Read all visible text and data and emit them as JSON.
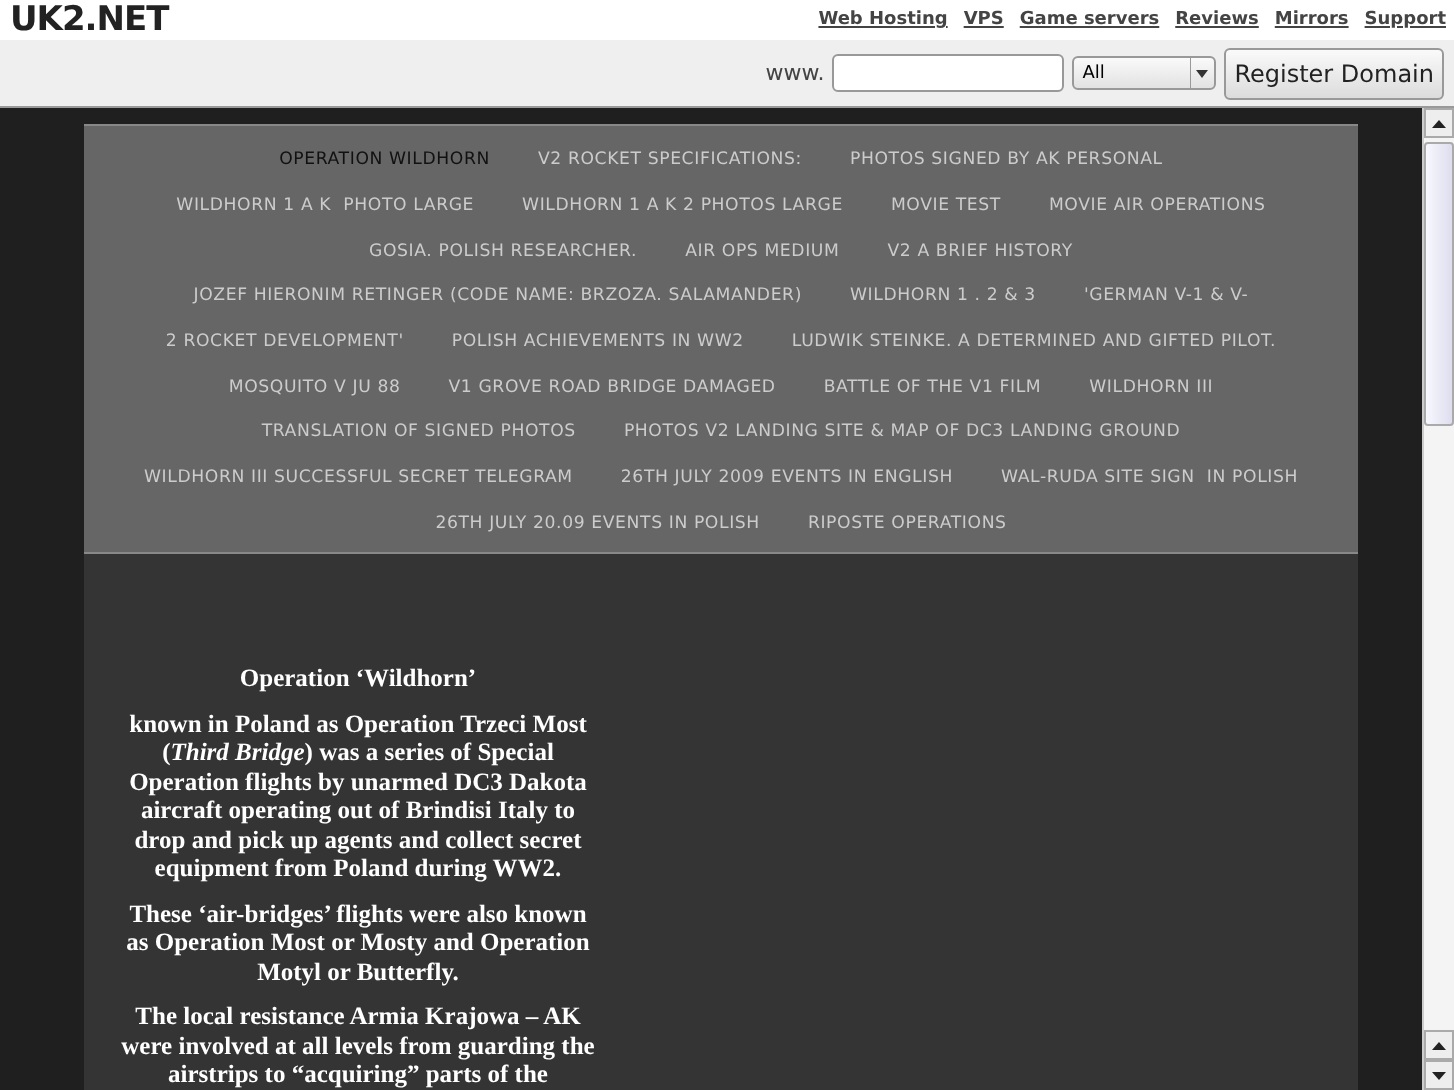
{
  "header": {
    "logo": "UK2.NET",
    "links": [
      "Web Hosting",
      "VPS",
      "Game servers",
      "Reviews",
      "Mirrors",
      "Support"
    ]
  },
  "domain_bar": {
    "prefix": "www.",
    "select": "All",
    "button": "Register Domain"
  },
  "nav_rows": [
    [
      {
        "label": "OPERATION WILDHORN",
        "selected": true
      },
      {
        "label": "V2 ROCKET SPECIFICATIONS:",
        "selected": false
      },
      {
        "label": "PHOTOS SIGNED BY AK PERSONAL",
        "selected": false
      }
    ],
    [
      {
        "label": "WILDHORN 1 A K  PHOTO LARGE",
        "selected": false
      },
      {
        "label": "WILDHORN 1 A K 2 PHOTOS LARGE",
        "selected": false
      },
      {
        "label": "MOVIE TEST",
        "selected": false
      },
      {
        "label": "MOVIE AIR OPERATIONS",
        "selected": false
      }
    ],
    [
      {
        "label": "GOSIA. POLISH RESEARCHER.",
        "selected": false
      },
      {
        "label": "AIR OPS MEDIUM",
        "selected": false
      },
      {
        "label": "V2 A BRIEF HISTORY",
        "selected": false
      }
    ],
    [
      {
        "label": "JOZEF HIERONIM RETINGER (CODE NAME: BRZOZA. SALAMANDER)",
        "selected": false
      },
      {
        "label": "WILDHORN 1 . 2 & 3",
        "selected": false
      },
      {
        "label": "'GERMAN V-1 & V-",
        "selected": false
      }
    ],
    [
      {
        "label": "2 ROCKET DEVELOPMENT'",
        "selected": false
      },
      {
        "label": "POLISH ACHIEVEMENTS IN WW2",
        "selected": false
      },
      {
        "label": "LUDWIK STEINKE. A DETERMINED AND GIFTED PILOT.",
        "selected": false
      }
    ],
    [
      {
        "label": "MOSQUITO V JU 88",
        "selected": false
      },
      {
        "label": "V1 GROVE ROAD BRIDGE DAMAGED",
        "selected": false
      },
      {
        "label": "BATTLE OF THE V1 FILM",
        "selected": false
      },
      {
        "label": "WILDHORN III",
        "selected": false
      }
    ],
    [
      {
        "label": "TRANSLATION OF SIGNED PHOTOS",
        "selected": false
      },
      {
        "label": "PHOTOS V2 LANDING SITE & MAP OF DC3 LANDING GROUND",
        "selected": false
      }
    ],
    [
      {
        "label": "WILDHORN III SUCCESSFUL SECRET TELEGRAM",
        "selected": false
      },
      {
        "label": "26TH JULY 2009 EVENTS IN ENGLISH",
        "selected": false
      },
      {
        "label": "WAL-RUDA SITE SIGN  IN POLISH",
        "selected": false
      }
    ],
    [
      {
        "label": "26TH JULY 20.09 EVENTS IN POLISH",
        "selected": false
      },
      {
        "label": "RIPOSTE OPERATIONS",
        "selected": false
      }
    ]
  ],
  "article": {
    "title": "Operation ‘Wildhorn’",
    "paragraphs": [
      "known in Poland as Operation Trzeci Most (*Third Bridge*) was a series of Special Operation flights by unarmed DC3 Dakota aircraft operating out of Brindisi Italy to drop and pick up agents and collect secret equipment from Poland during WW2.",
      "These ‘air-bridges’ flights were also known as Operation Most or Mosty and Operation Motyl or Butterfly.",
      "The local resistance Armia Krajowa – AK were involved at all levels from guarding the airstrips to “acquiring” parts of the"
    ]
  }
}
